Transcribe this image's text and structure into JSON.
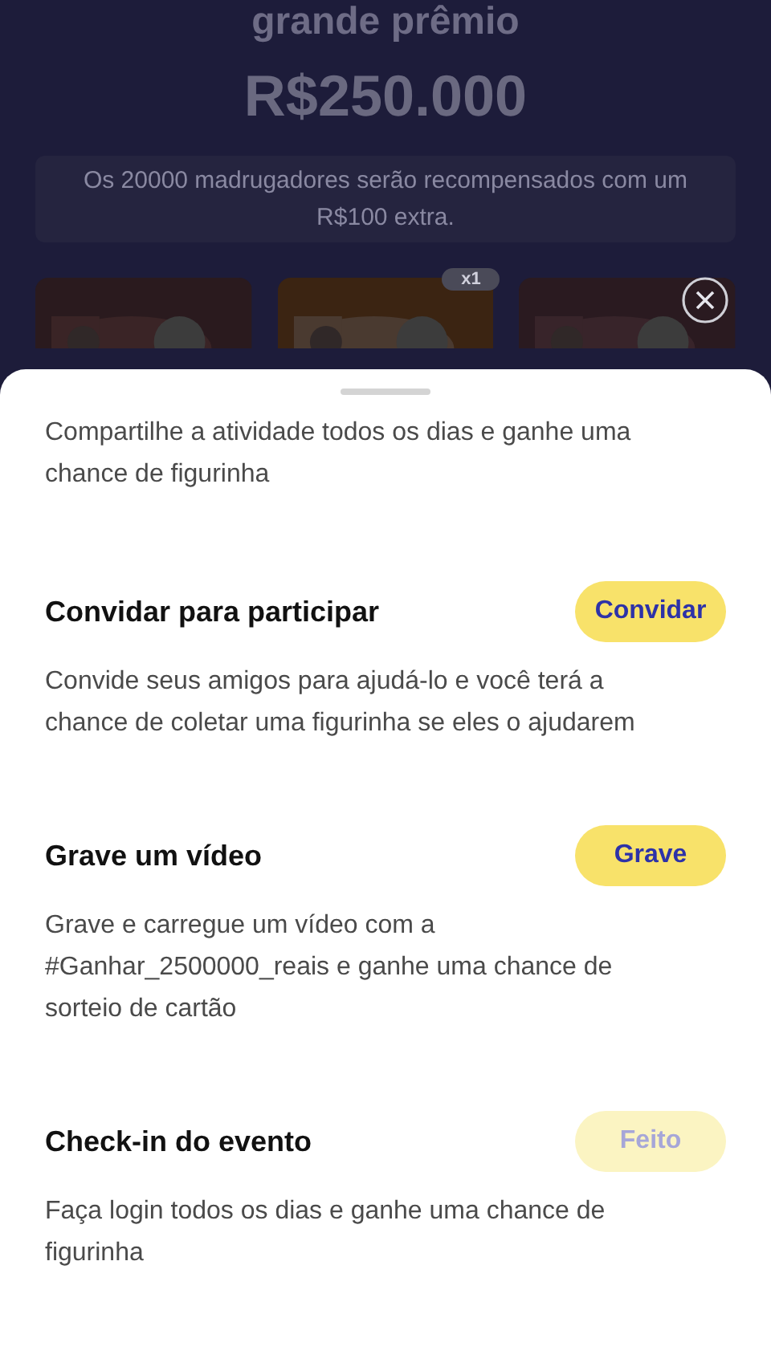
{
  "background": {
    "heading": "grande prêmio",
    "prize": "R$250.000",
    "banner": "Os 20000 madrugadores serão recompensados com um R$100 extra.",
    "cards": [
      {
        "kind": "picture"
      },
      {
        "kind": "picture",
        "badge": "x1"
      },
      {
        "kind": "picture"
      }
    ]
  },
  "sheet": {
    "intro": "Compartilhe a atividade todos os dias e ganhe uma chance de figurinha",
    "tasks": [
      {
        "title": "Convidar para participar",
        "button": "Convidar",
        "done": false,
        "description": "Convide seus amigos para ajudá-lo e você terá a chance de coletar uma figurinha se eles o ajudarem"
      },
      {
        "title": "Grave um vídeo",
        "button": "Grave",
        "done": false,
        "description": "Grave e carregue um vídeo com a #Ganhar_2500000_reais e ganhe uma chance de sorteio de cartão"
      },
      {
        "title": "Check-in do evento",
        "button": "Feito",
        "done": true,
        "description": "Faça login todos os dias e ganhe uma chance de figurinha"
      }
    ]
  }
}
